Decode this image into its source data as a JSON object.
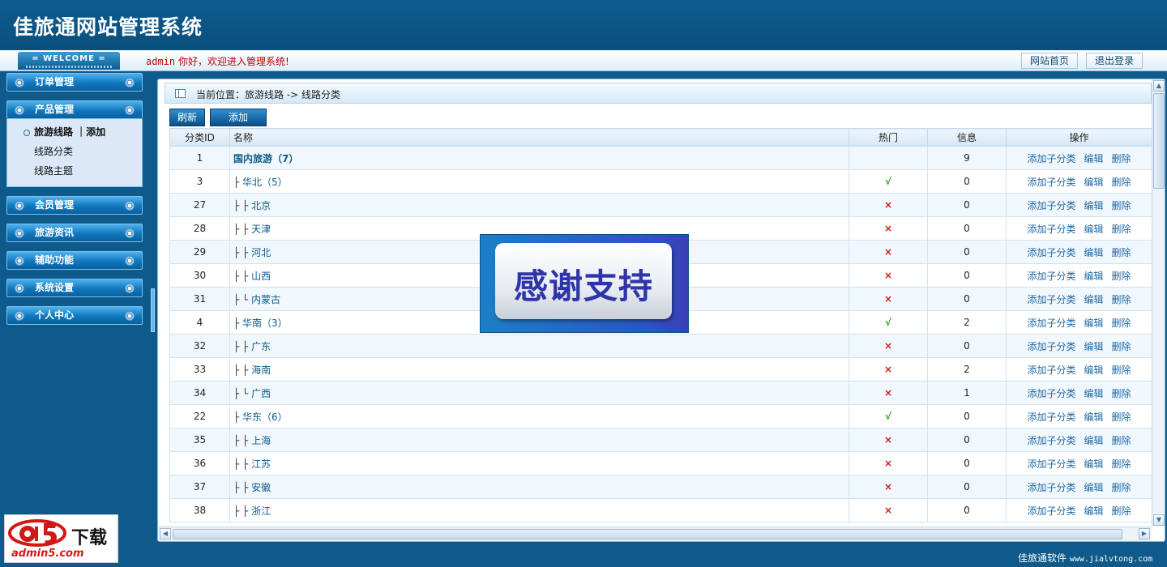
{
  "header": {
    "title": "佳旅通网站管理系统"
  },
  "topbar": {
    "welcome": "= WELCOME =",
    "greeting_user": "admin",
    "greeting_text": " 你好，欢迎进入管理系统!",
    "home_label": "网站首页",
    "logout_label": "退出登录"
  },
  "sidebar": {
    "menus": [
      "订单管理",
      "产品管理",
      "会员管理",
      "旅游资讯",
      "辅助功能",
      "系统设置",
      "个人中心"
    ],
    "submenu": [
      "旅游线路 ｜添加",
      "线路分类",
      "线路主题"
    ]
  },
  "main": {
    "location": "当前位置：旅游线路 -> 线路分类",
    "refresh_label": "刷新",
    "add_label": "添加",
    "columns": [
      "分类ID",
      "名称",
      "热门",
      "信息",
      "操作"
    ],
    "ops": [
      "添加子分类",
      "编辑",
      "删除"
    ],
    "rows": [
      {
        "id": "1",
        "prefix": "",
        "name": "国内旅游（7）",
        "hot": "",
        "info": "9"
      },
      {
        "id": "3",
        "prefix": "├ ",
        "name": "华北（5）",
        "hot": "√",
        "info": "0"
      },
      {
        "id": "27",
        "prefix": "├ ├ ",
        "name": "北京",
        "hot": "×",
        "info": "0"
      },
      {
        "id": "28",
        "prefix": "├ ├ ",
        "name": "天津",
        "hot": "×",
        "info": "0"
      },
      {
        "id": "29",
        "prefix": "├ ├ ",
        "name": "河北",
        "hot": "×",
        "info": "0"
      },
      {
        "id": "30",
        "prefix": "├ ├ ",
        "name": "山西",
        "hot": "×",
        "info": "0"
      },
      {
        "id": "31",
        "prefix": "├ └ ",
        "name": "内蒙古",
        "hot": "×",
        "info": "0"
      },
      {
        "id": "4",
        "prefix": "├ ",
        "name": "华南（3）",
        "hot": "√",
        "info": "2"
      },
      {
        "id": "32",
        "prefix": "├ ├ ",
        "name": "广东",
        "hot": "×",
        "info": "0"
      },
      {
        "id": "33",
        "prefix": "├ ├ ",
        "name": "海南",
        "hot": "×",
        "info": "2"
      },
      {
        "id": "34",
        "prefix": "├ └ ",
        "name": "广西",
        "hot": "×",
        "info": "1"
      },
      {
        "id": "22",
        "prefix": "├ ",
        "name": "华东（6）",
        "hot": "√",
        "info": "0"
      },
      {
        "id": "35",
        "prefix": "├ ├ ",
        "name": "上海",
        "hot": "×",
        "info": "0"
      },
      {
        "id": "36",
        "prefix": "├ ├ ",
        "name": "江苏",
        "hot": "×",
        "info": "0"
      },
      {
        "id": "37",
        "prefix": "├ ├ ",
        "name": "安徽",
        "hot": "×",
        "info": "0"
      },
      {
        "id": "38",
        "prefix": "├ ├ ",
        "name": "浙江",
        "hot": "×",
        "info": "0"
      }
    ]
  },
  "overlay": {
    "text": "感谢支持"
  },
  "logo": {
    "brand": "下载",
    "domain": "admin5.com"
  },
  "footer": {
    "brand": "佳旅通软件",
    "url": "www.jialvtong.com"
  },
  "colors": {
    "header_bg": "#0e5a8a",
    "hot_yes": "#1a9b1a",
    "hot_no": "#d21818",
    "link": "#1f6aa5",
    "greeting": "#c00000"
  }
}
